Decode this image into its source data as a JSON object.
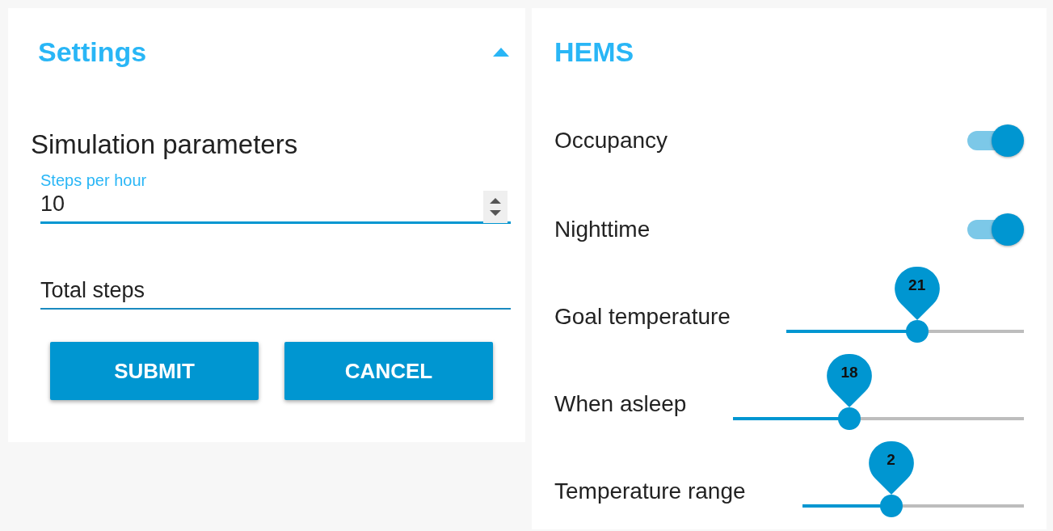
{
  "settings": {
    "title": "Settings",
    "expanded": true,
    "section_title": "Simulation parameters",
    "fields": [
      {
        "label": "Steps per hour",
        "value": "10",
        "focused": true
      },
      {
        "placeholder": "Total steps",
        "focused": false
      }
    ],
    "buttons": [
      "SUBMIT",
      "CANCEL"
    ]
  },
  "hems": {
    "title": "HEMS",
    "rows": [
      {
        "kind": "toggle",
        "label": "Occupancy",
        "on": true
      },
      {
        "kind": "toggle",
        "label": "Nighttime",
        "on": true
      },
      {
        "kind": "slider",
        "label": "Goal temperature",
        "value": "21",
        "level": 0.55
      },
      {
        "kind": "slider",
        "label": "When asleep",
        "value": "18",
        "level": 0.4
      },
      {
        "kind": "slider",
        "label": "Temperature range",
        "value": "2",
        "level": 0.4
      }
    ]
  }
}
